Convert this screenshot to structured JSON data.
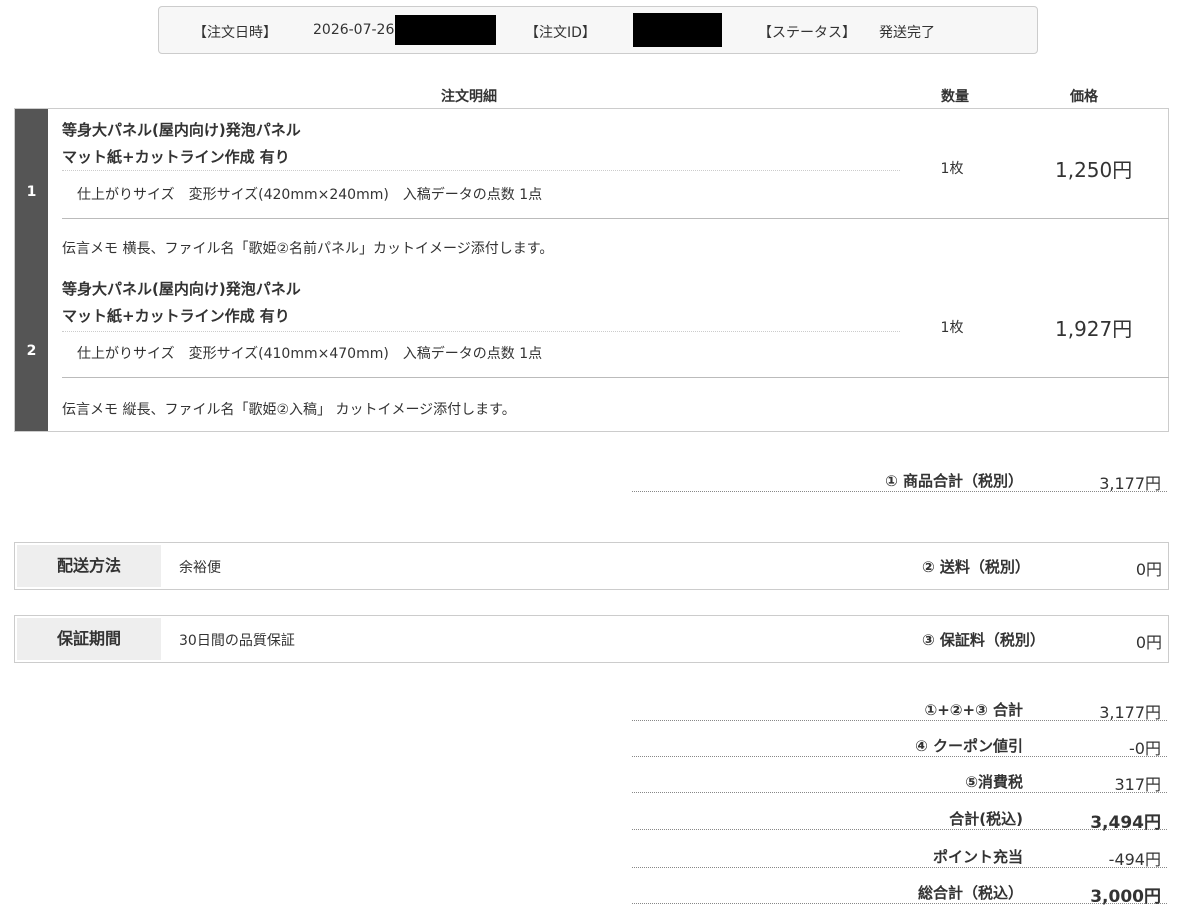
{
  "order": {
    "date_label": "【注文日時】",
    "date_value": "2026-07-26",
    "id_label": "【注文ID】",
    "status_label": "【ステータス】",
    "status_value": "発送完了"
  },
  "columns": {
    "detail": "注文明細",
    "qty": "数量",
    "price": "価格"
  },
  "items": [
    {
      "no": "1",
      "name": "等身大パネル(屋内向け)発泡パネル",
      "option": "マット紙+カットライン作成 有り",
      "spec": "仕上がりサイズ　変形サイズ(420mm×240mm)　入稿データの点数 1点",
      "qty": "1枚",
      "price": "1,250円",
      "memo": "伝言メモ  横長、ファイル名「歌姫②名前パネル」カットイメージ添付します。"
    },
    {
      "no": "2",
      "name": "等身大パネル(屋内向け)発泡パネル",
      "option": "マット紙+カットライン作成 有り",
      "spec": "仕上がりサイズ　変形サイズ(410mm×470mm)　入稿データの点数 1点",
      "qty": "1枚",
      "price": "1,927円",
      "memo": "伝言メモ  縦長、ファイル名「歌姫②入稿」 カットイメージ添付します。"
    }
  ],
  "subtotal": {
    "label": "① 商品合計（税別）",
    "value": "3,177円"
  },
  "shipping": {
    "label": "配送方法",
    "value": "余裕便",
    "fee_label": "② 送料（税別）",
    "fee_value": "0円"
  },
  "warranty": {
    "label": "保証期間",
    "value": "30日間の品質保証",
    "fee_label": "③ 保証料（税別）",
    "fee_value": "0円"
  },
  "totals": [
    {
      "label": "①+②+③ 合計",
      "value": "3,177円"
    },
    {
      "label": "④ クーポン値引",
      "value": "-0円"
    },
    {
      "label": "⑤消費税",
      "value": "317円"
    },
    {
      "label": "合計(税込)",
      "value": "3,494円"
    },
    {
      "label": "ポイント充当",
      "value": "-494円"
    },
    {
      "label": "総合計（税込）",
      "value": "3,000円"
    }
  ]
}
